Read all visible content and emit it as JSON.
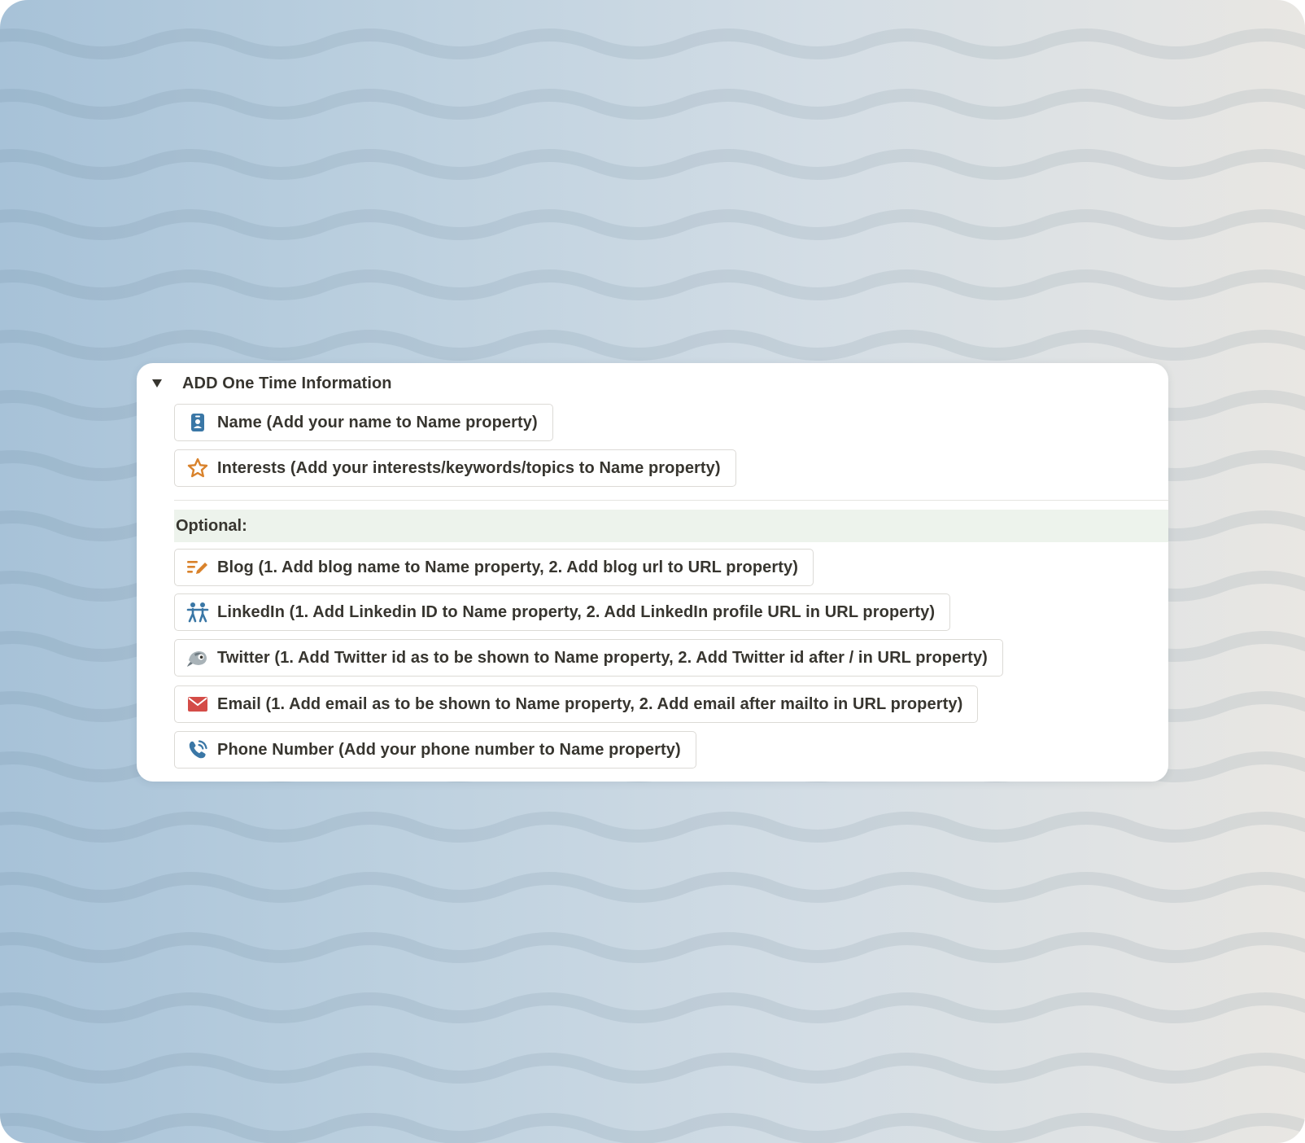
{
  "toggle": {
    "title": "ADD One Time Information",
    "expanded": true
  },
  "items": [
    {
      "label": "Name (Add your name to Name property)",
      "icon": "contact-card-icon"
    },
    {
      "label": "Interests (Add your interests/keywords/topics to Name property)",
      "icon": "star-icon"
    }
  ],
  "optional": {
    "heading": "Optional:",
    "items": [
      {
        "label": "Blog (1. Add blog name to Name property, 2. Add blog url to URL property)",
        "icon": "pencil-lines-icon"
      },
      {
        "label": "LinkedIn (1. Add Linkedin ID to Name property, 2. Add LinkedIn profile URL in URL property)",
        "icon": "people-icon"
      },
      {
        "label": "Twitter (1. Add Twitter id as to be shown to Name property, 2. Add Twitter id after / in URL property)",
        "icon": "bird-icon"
      },
      {
        "label": "Email (1. Add email as to be shown to Name property, 2. Add email after mailto in URL property)",
        "icon": "envelope-icon"
      },
      {
        "label": "Phone Number (Add your phone number to Name property)",
        "icon": "phone-icon"
      }
    ]
  },
  "colors": {
    "text": "#37352f",
    "optional_highlight": "#edf3ec",
    "icon_blue": "#3a77a6",
    "icon_orange": "#d9822b",
    "icon_red": "#d44c47"
  }
}
